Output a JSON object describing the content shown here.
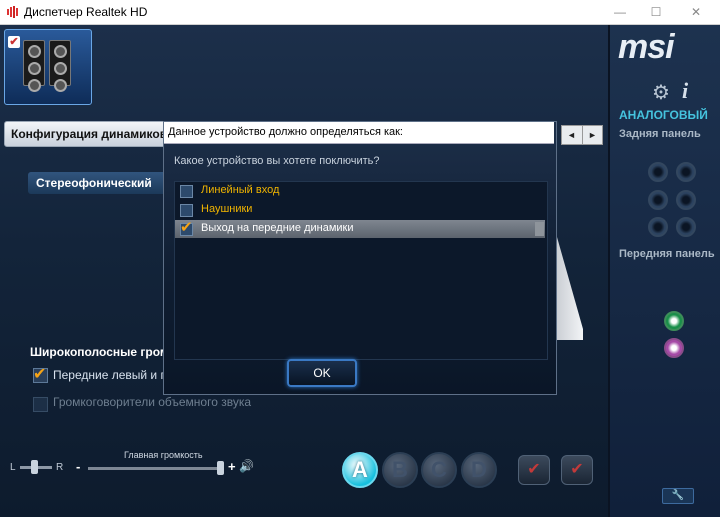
{
  "window": {
    "title": "Диспетчер Realtek HD",
    "controls": [
      "—",
      "☐",
      "✕"
    ]
  },
  "main": {
    "speaker_config_tab": "Конфигурация динамиков",
    "speaker_mode": "Стереофонический",
    "wideband_title": "Широкополосные громкоговорители",
    "front_lr_label": "Передние левый и правый",
    "front_lr_checked": true,
    "surround_label": "Громкоговорители объемного звука",
    "surround_checked": false
  },
  "right_panel": {
    "logo": "msi",
    "section": "АНАЛОГОВЫЙ",
    "rear_panel": "Задняя панель",
    "front_panel": "Передняя панель",
    "rear_jacks": 6,
    "front_jacks": [
      "green",
      "pink"
    ],
    "accent_color": "#45c3de"
  },
  "volume": {
    "main_label": "Главная громкость",
    "balance_left": "L",
    "balance_right": "R",
    "level_percent": 100,
    "balance_percent": 50,
    "minus": "-",
    "plus": "+",
    "speaker_icon": "🔊"
  },
  "profile_buttons": [
    "A",
    "B",
    "C",
    "D"
  ],
  "dialog": {
    "title": "Данное устройство должно определяться как:",
    "question": "Какое устройство вы хотете поключить?",
    "options": [
      {
        "label": "Линейный вход",
        "checked": false,
        "color": "#f0b400"
      },
      {
        "label": "Наушники",
        "checked": false,
        "color": "#f0b400"
      },
      {
        "label": "Выход на передние динамики",
        "checked": true,
        "color": "#ffffff"
      }
    ],
    "ok_label": "OK",
    "nav_prev": "◄",
    "nav_next": "►"
  }
}
